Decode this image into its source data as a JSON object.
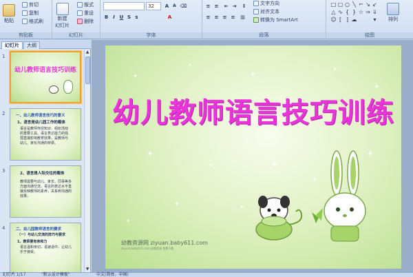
{
  "ribbon": {
    "clipboard": {
      "paste": "粘贴",
      "cut": "剪切",
      "copy": "复制",
      "format_painter": "格式刷",
      "label": "剪贴板"
    },
    "slides": {
      "new_slide": "新建",
      "new_slide_2": "幻灯片",
      "layout": "版式",
      "reset": "重设",
      "delete": "删除",
      "label": "幻灯片"
    },
    "font": {
      "font_size": "32",
      "label": "字体"
    },
    "paragraph": {
      "text_direction": "文字方向",
      "align_text": "对齐文本",
      "smartart": "转换为 SmartArt",
      "label": "段落"
    },
    "drawing": {
      "arrange": "排列",
      "label": "绘图"
    }
  },
  "left_pane": {
    "tabs": [
      "幻灯片",
      "大纲"
    ],
    "thumbnails": [
      {
        "num": "1",
        "title": "幼儿教师语言技巧训练"
      },
      {
        "num": "2",
        "head": "一、幼儿教师语言技巧的意义",
        "sub": "1、语言是幼儿园工作的载体",
        "body": "语言是教师传授知识、组织活动的重要工具。语言表达能力的强弱直接影响教育效果，是教师与幼儿、家长沟通的桥梁。"
      },
      {
        "num": "3",
        "head": "2、语言是人际交往的载体",
        "body": "教师需要与幼儿、家长、同事等多方面沟通交流，语言的表达水平直接反映教师的素养，关系到沟通的效果。"
      },
      {
        "num": "4",
        "head": "二、幼儿园教师语言的要求",
        "sub": "（一）与幼儿交流的技巧与要求",
        "sub2": "1、教师要有亲和力",
        "body": "语言温和亲切，语速适中，让幼儿乐于接受。"
      }
    ]
  },
  "slide": {
    "title": "幼儿教师语言技巧训练",
    "footer_url": "幼教资源网 ziyuan.baby611.com",
    "footer_small": "ziyuan.baby611.com 幼教资源 免费下载"
  },
  "status": {
    "slide_info": "幻灯片 1/17",
    "theme": "\"默认设计模板\"",
    "language": "中文(简体，中国)"
  },
  "colors": {
    "title_pink": "#e834d8",
    "selected_border": "#f0a030",
    "ribbon_bg": "#dbe6f4"
  }
}
